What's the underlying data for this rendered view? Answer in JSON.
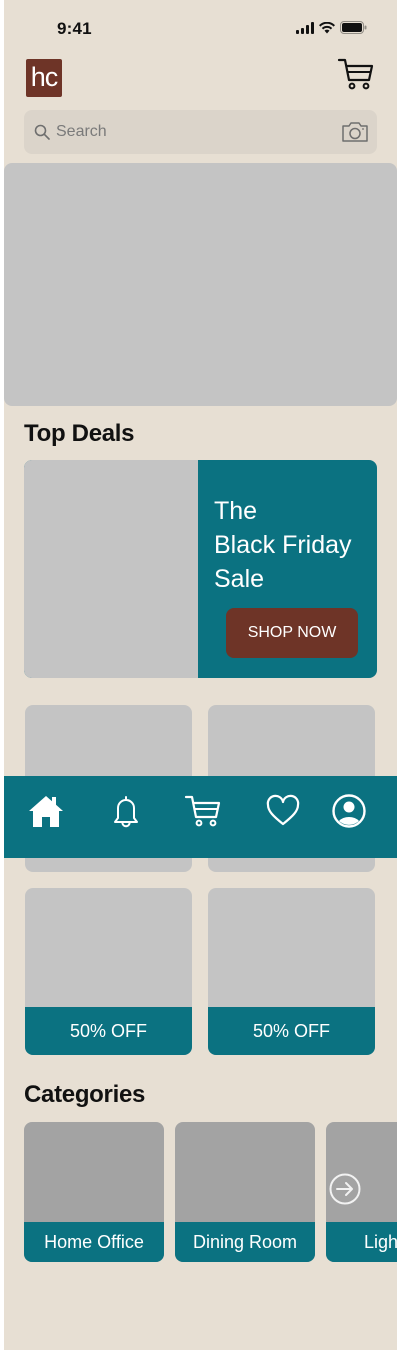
{
  "status_bar": {
    "time": "9:41"
  },
  "header": {
    "logo_text": "hc"
  },
  "search": {
    "placeholder": "Search"
  },
  "top_deals": {
    "title": "Top Deals",
    "promo": {
      "line1": "The",
      "line2": "Black Friday",
      "line3": "Sale",
      "button_label": "SHOP NOW"
    },
    "tiles": [
      {
        "discount": "50% OFF"
      },
      {
        "discount": "50% OFF"
      }
    ]
  },
  "bottom_nav": {
    "items": [
      {
        "icon": "home-icon"
      },
      {
        "icon": "bell-icon"
      },
      {
        "icon": "cart-icon"
      },
      {
        "icon": "heart-icon"
      },
      {
        "icon": "profile-icon"
      }
    ]
  },
  "categories": {
    "title": "Categories",
    "items": [
      {
        "label": "Home Office"
      },
      {
        "label": "Dining Room"
      },
      {
        "label": "Ligh"
      }
    ]
  },
  "colors": {
    "background": "#e7dfd3",
    "teal": "#0b7281",
    "brown": "#6e3427",
    "placeholder_gray": "#c4c4c4"
  }
}
